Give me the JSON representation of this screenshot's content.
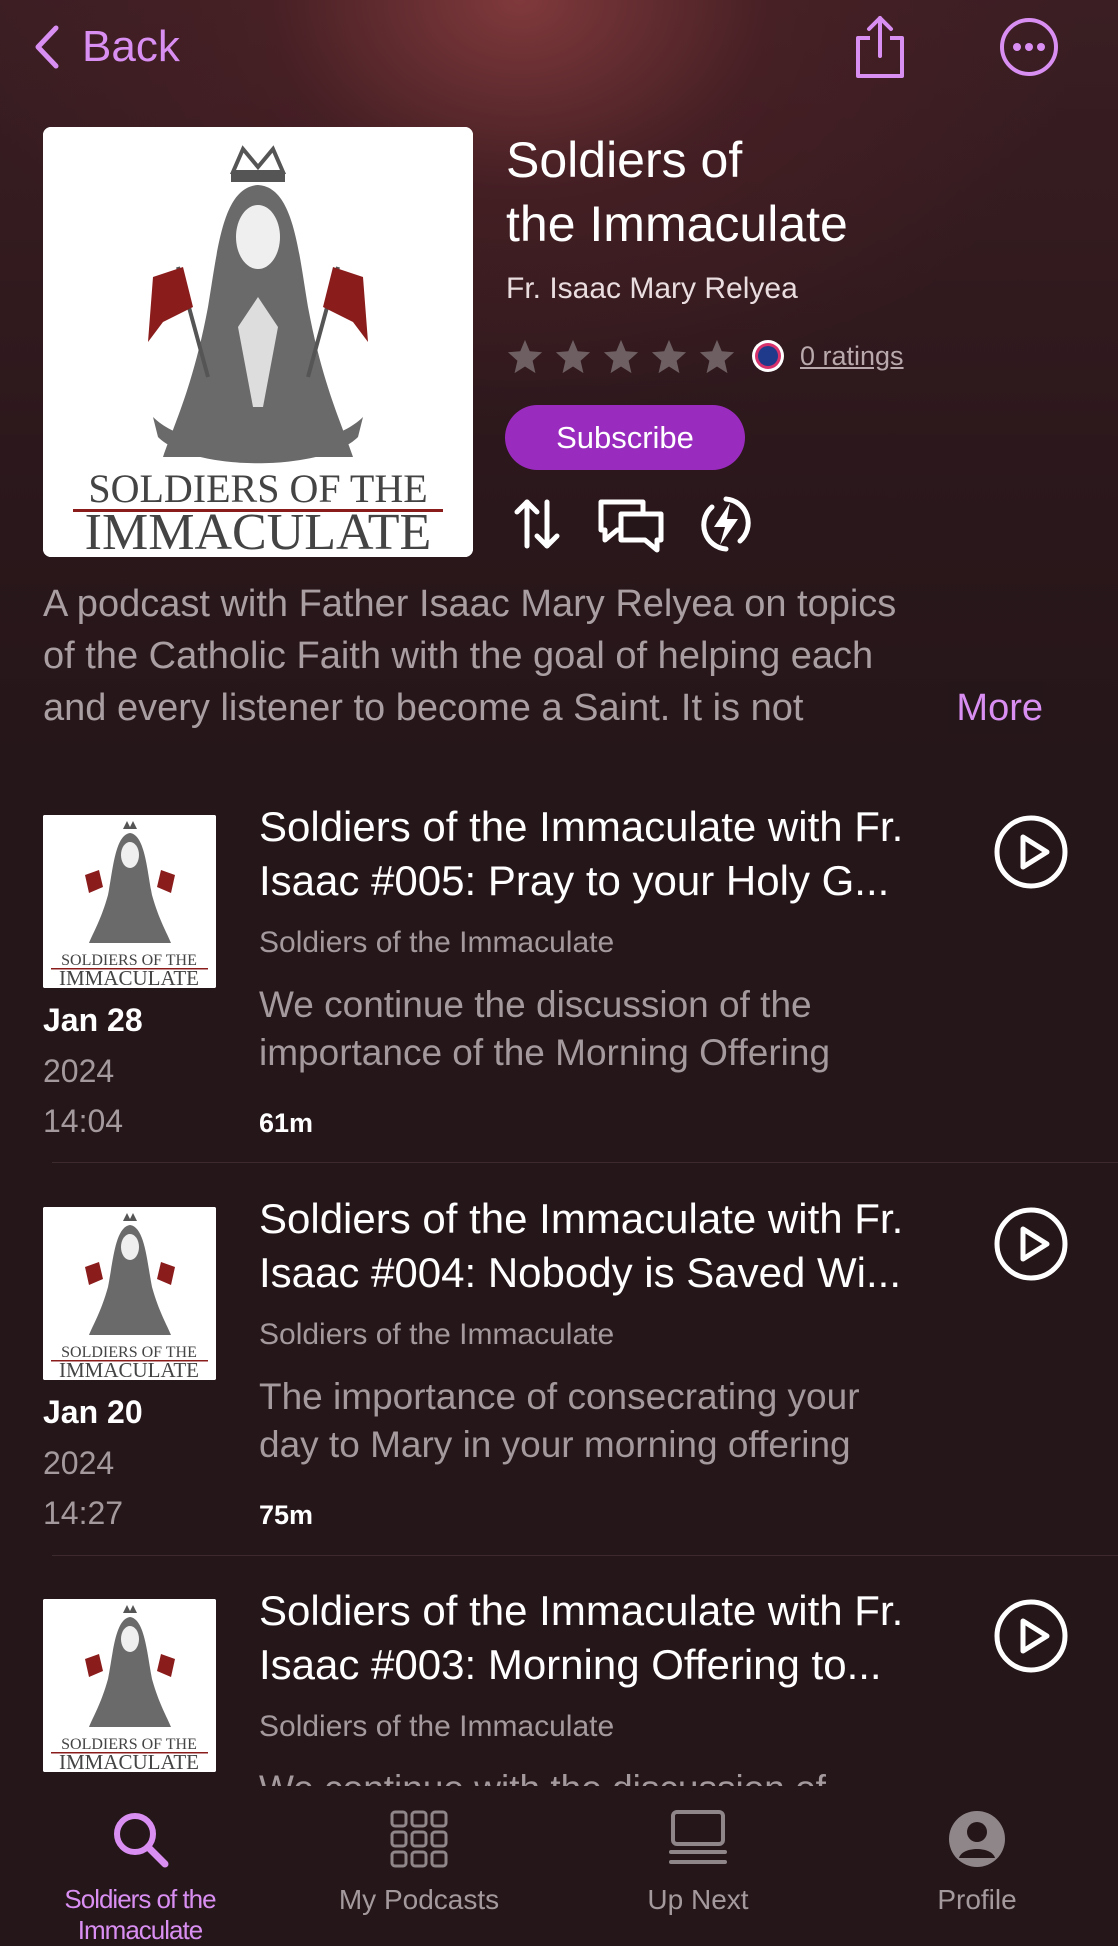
{
  "nav": {
    "back_label": "Back"
  },
  "podcast": {
    "title_line1": "Soldiers of",
    "title_line2": "the Immaculate",
    "author": "Fr. Isaac Mary Relyea",
    "ratings_label": "0 ratings",
    "subscribe_label": "Subscribe",
    "description_lines": [
      "A podcast with Father Isaac Mary Relyea on topics",
      "of the Catholic Faith with the goal of helping each",
      "and every listener to become a Saint. It is not"
    ],
    "more_label": "More",
    "artwork_line1": "SOLDIERS OF THE",
    "artwork_line2": "IMMACULATE",
    "accent_color": "#d98ef2",
    "subscribe_color": "#9a2bbf"
  },
  "episodes": [
    {
      "title_line1": "Soldiers of the Immaculate with Fr.",
      "title_line2": "Isaac #005: Pray to your Holy G...",
      "show": "Soldiers of the Immaculate",
      "desc_line1": "We continue the discussion of the",
      "desc_line2": "importance of the Morning Offering",
      "date": "Jan 28",
      "year": "2024",
      "time": "14:04",
      "duration": "61m"
    },
    {
      "title_line1": "Soldiers of the Immaculate with Fr.",
      "title_line2": "Isaac #004: Nobody is Saved Wi...",
      "show": "Soldiers of the Immaculate",
      "desc_line1": "The importance of consecrating your",
      "desc_line2": "day to Mary in your morning offering",
      "date": "Jan 20",
      "year": "2024",
      "time": "14:27",
      "duration": "75m"
    },
    {
      "title_line1": "Soldiers of the Immaculate with Fr.",
      "title_line2": "Isaac #003: Morning Offering to...",
      "show": "Soldiers of the Immaculate",
      "desc_line1": "We continue with the discussion of"
    }
  ],
  "tabs": [
    {
      "label": "Soldiers of the Immaculate",
      "icon": "search-icon",
      "active": true
    },
    {
      "label": "My Podcasts",
      "icon": "grid-icon"
    },
    {
      "label": "Up Next",
      "icon": "queue-icon"
    },
    {
      "label": "Profile",
      "icon": "profile-icon"
    }
  ]
}
